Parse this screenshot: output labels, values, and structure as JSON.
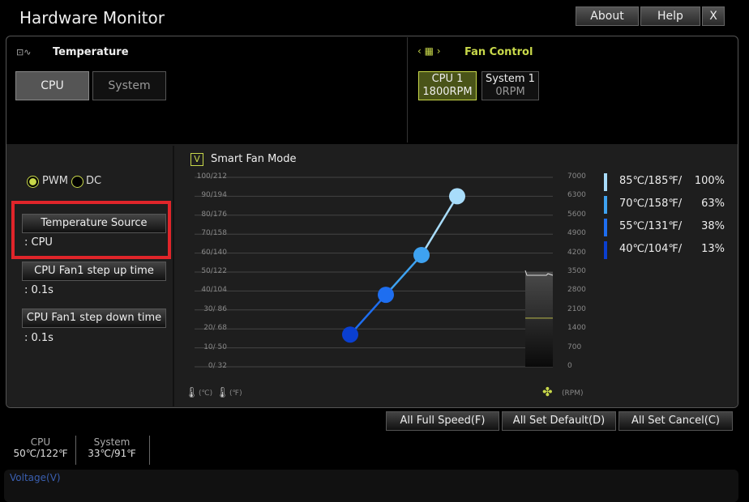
{
  "app": {
    "title": "Hardware Monitor",
    "about": "About",
    "help": "Help",
    "close": "X"
  },
  "temperature": {
    "title": "Temperature",
    "tabs": [
      "CPU",
      "System"
    ],
    "active": "CPU"
  },
  "fan_control": {
    "title": "Fan Control",
    "fans": [
      {
        "name": "CPU 1",
        "rpm": "1800RPM",
        "active": true
      },
      {
        "name": "System 1",
        "rpm": "0RPM",
        "active": false
      }
    ]
  },
  "mode": {
    "pwm": "PWM",
    "dc": "DC",
    "selected": "PWM"
  },
  "settings": [
    {
      "label": "Temperature Source",
      "value": ": CPU"
    },
    {
      "label": "CPU Fan1 step up time",
      "value": ": 0.1s"
    },
    {
      "label": "CPU Fan1 step down time",
      "value": ": 0.1s"
    }
  ],
  "smart_fan": {
    "label": "Smart Fan Mode",
    "check": "V",
    "checked": true
  },
  "chart_data": {
    "type": "line",
    "left_ticks": [
      "100/212",
      "90/194",
      "80/176",
      "70/158",
      "60/140",
      "50/122",
      "40/104",
      "30/  86",
      "20/  68",
      "10/  50",
      "0/  32"
    ],
    "right_ticks": [
      "7000",
      "6300",
      "5600",
      "4900",
      "4200",
      "3500",
      "2800",
      "2100",
      "1400",
      "700",
      "0"
    ],
    "left_unit_c": "(℃)",
    "left_unit_f": "(℉)",
    "right_unit": "(RPM)",
    "ylim": [
      0,
      100
    ],
    "rpm_lim": [
      0,
      7000
    ],
    "current_rpm": 1800,
    "points": [
      {
        "x": 40,
        "y": 17,
        "color": "#0a3fd0"
      },
      {
        "x": 55,
        "y": 38,
        "color": "#1e6ef0"
      },
      {
        "x": 70,
        "y": 59,
        "color": "#3ea2f0"
      },
      {
        "x": 85,
        "y": 90,
        "color": "#a8dcfa"
      }
    ],
    "legend": [
      {
        "temp": "85℃/185℉/",
        "pct": "100%",
        "color": "#a8dcfa"
      },
      {
        "temp": "70℃/158℉/",
        "pct": "63%",
        "color": "#3ea2f0"
      },
      {
        "temp": "55℃/131℉/",
        "pct": "38%",
        "color": "#1e6ef0"
      },
      {
        "temp": "40℃/104℉/",
        "pct": "13%",
        "color": "#0a3fd0"
      }
    ]
  },
  "actions": {
    "full": "All Full Speed(F)",
    "default": "All Set Default(D)",
    "cancel": "All Set Cancel(C)"
  },
  "status": [
    {
      "name": "CPU",
      "value": "50℃/122℉"
    },
    {
      "name": "System",
      "value": "33℃/91℉"
    }
  ],
  "voltage": {
    "label": "Voltage(V)"
  },
  "colors": {
    "accent": "#c8d84a",
    "highlight": "#e0252a"
  }
}
